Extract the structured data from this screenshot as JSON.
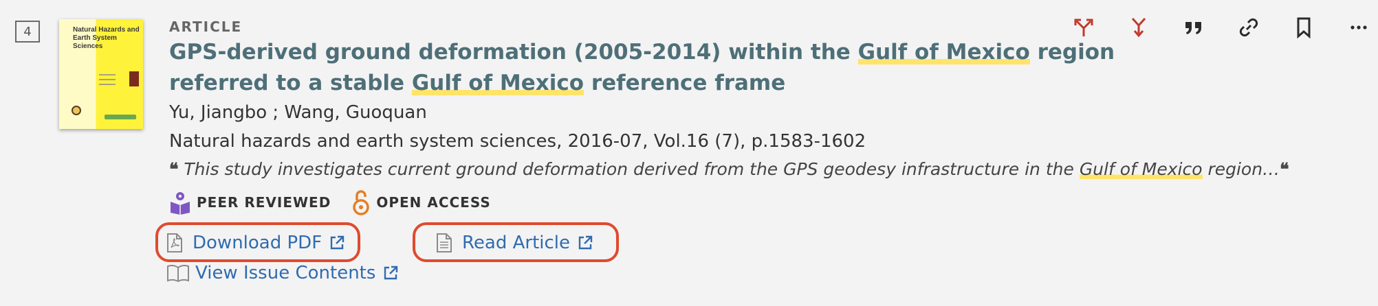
{
  "result": {
    "number": "4",
    "type": "ARTICLE",
    "title_parts": [
      "GPS-derived ground deformation (2005-2014) within the ",
      "Gulf of Mexico",
      " region referred to a stable ",
      "Gulf of Mexico",
      " reference frame"
    ],
    "authors": "Yu, Jiangbo ; Wang, Guoquan",
    "source": "Natural hazards and earth system sciences, 2016-07, Vol.16 (7), p.1583-1602",
    "snippet_parts": [
      "This study investigates current ground deformation derived from the GPS geodesy infrastructure in the ",
      "Gulf of Mexico",
      " region…"
    ],
    "quote_glyph": "❝",
    "thumbnail": {
      "title": "Natural Hazards and Earth System Sciences",
      "bg": "#fff23a"
    }
  },
  "badges": {
    "peer_reviewed": "PEER REVIEWED",
    "open_access": "OPEN ACCESS"
  },
  "links": {
    "download_pdf": "Download PDF",
    "read_article": "Read Article",
    "view_issue": "View Issue Contents"
  },
  "actions": [
    "citation-trail-icon",
    "cited-by-icon",
    "quote-icon",
    "link-icon",
    "bookmark-icon",
    "more-icon"
  ],
  "colors": {
    "title": "#4e6f78",
    "link": "#2f6bb0",
    "highlight": "#ffe46a",
    "red_icon": "#c0392b",
    "peer": "#7e57c2",
    "open_access": "#e67e22",
    "focus_ring": "#e04a2e"
  }
}
